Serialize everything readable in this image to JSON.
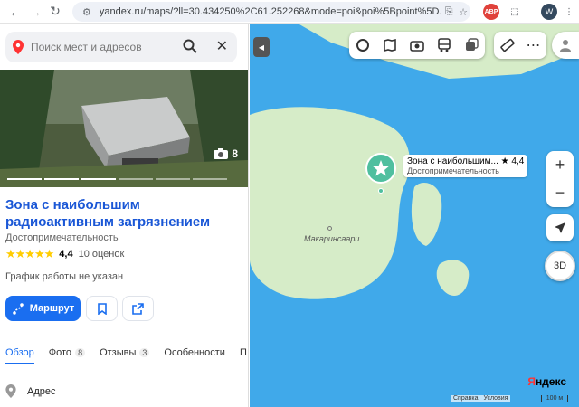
{
  "browser": {
    "url": "yandex.ru/maps/?ll=30.434250%2C61.252268&mode=poi&poi%5Bpoint%5D...",
    "profile_initial": "W",
    "abp_label": "ABP"
  },
  "search": {
    "placeholder": "Поиск мест и адресов"
  },
  "place": {
    "photo_count": "8",
    "title": "Зона с наибольшим радиоактивным загрязнением",
    "category": "Достопримечательность",
    "stars": "★★★★★",
    "rating": "4,4",
    "reviews": "10 оценок",
    "hours": "График работы не указан",
    "route_label": "Маршрут"
  },
  "tabs": [
    {
      "label": "Обзор",
      "badge": ""
    },
    {
      "label": "Фото",
      "badge": "8"
    },
    {
      "label": "Отзывы",
      "badge": "3"
    },
    {
      "label": "Особенности",
      "badge": ""
    },
    {
      "label": "П",
      "badge": ""
    }
  ],
  "address": {
    "label": "Адрес"
  },
  "map": {
    "poi_name": "Зона с наибольшим...",
    "poi_rating": "★ 4,4",
    "poi_category": "Достопримечательность",
    "island_name": "Макаринсаари",
    "zoom_in": "+",
    "zoom_out": "−",
    "btn_3d": "3D",
    "logo_prefix": "Я",
    "logo_rest": "ндекс",
    "links": [
      "Справка",
      "Условия"
    ],
    "scale": "100 м"
  },
  "colors": {
    "water": "#40a9ea",
    "land": "#d6ecc8",
    "accent": "#1a6ef0",
    "title": "#1a57d6",
    "poi": "#4fbf9f"
  }
}
